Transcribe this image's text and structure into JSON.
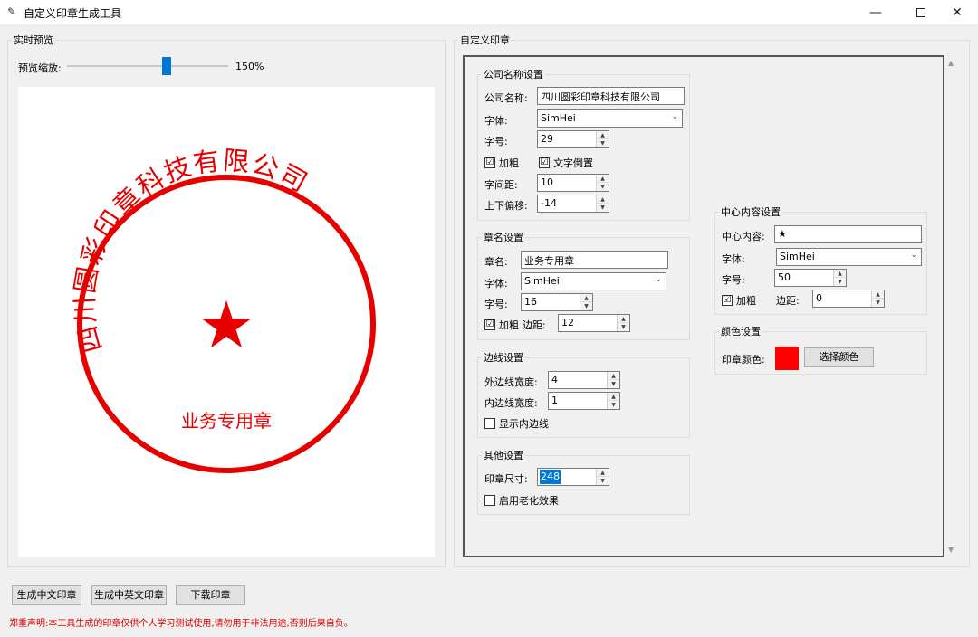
{
  "window": {
    "title": "自定义印章生成工具",
    "icon": "feather-icon",
    "controls": {
      "minimize": "—",
      "close": "✕"
    }
  },
  "preview": {
    "group_title": "实时预览",
    "zoom_label": "预览缩放:",
    "zoom_value_text": "150%",
    "zoom_fraction": 0.62
  },
  "stamp": {
    "company": "四川圆彩印章科技有限公司",
    "center": "★",
    "name": "业务专用章",
    "color": "#e60000"
  },
  "settings": {
    "group_title": "自定义印章",
    "company": {
      "title": "公司名称设置",
      "name_label": "公司名称:",
      "name_value": "四川圆彩印章科技有限公司",
      "font_label": "字体:",
      "font_value": "SimHei",
      "size_label": "字号:",
      "size_value": "29",
      "bold_label": "加粗",
      "bold_checked": "☑",
      "invert_label": "文字倒置",
      "invert_checked": "☑",
      "spacing_label": "字间距:",
      "spacing_value": "10",
      "offset_label": "上下偏移:",
      "offset_value": "-14"
    },
    "seal_name": {
      "title": "章名设置",
      "name_label": "章名:",
      "name_value": "业务专用章",
      "font_label": "字体:",
      "font_value": "SimHei",
      "size_label": "字号:",
      "size_value": "16",
      "bold_label": "加粗",
      "bold_checked": "☑",
      "margin_label": "边距:",
      "margin_value": "12"
    },
    "border": {
      "title": "边线设置",
      "outer_label": "外边线宽度:",
      "outer_value": "4",
      "inner_label": "内边线宽度:",
      "inner_value": "1",
      "show_inner_label": "显示内边线"
    },
    "other": {
      "title": "其他设置",
      "size_label": "印章尺寸:",
      "size_value": "248",
      "aging_label": "启用老化效果"
    },
    "center": {
      "title": "中心内容设置",
      "content_label": "中心内容:",
      "content_value": "★",
      "font_label": "字体:",
      "font_value": "SimHei",
      "size_label": "字号:",
      "size_value": "50",
      "bold_label": "加粗",
      "bold_checked": "☑",
      "margin_label": "边距:",
      "margin_value": "0"
    },
    "color": {
      "title": "颜色设置",
      "label": "印章颜色:",
      "button": "选择颜色",
      "swatch": "#ff0000"
    }
  },
  "actions": {
    "gen_cn": "生成中文印章",
    "gen_cn_en": "生成中英文印章",
    "download": "下载印章"
  },
  "disclaimer": {
    "text": "郑重声明:本工具生成的印章仅供个人学习测试使用,请勿用于非法用途,否则后果自负。",
    "color": "#e00000"
  }
}
